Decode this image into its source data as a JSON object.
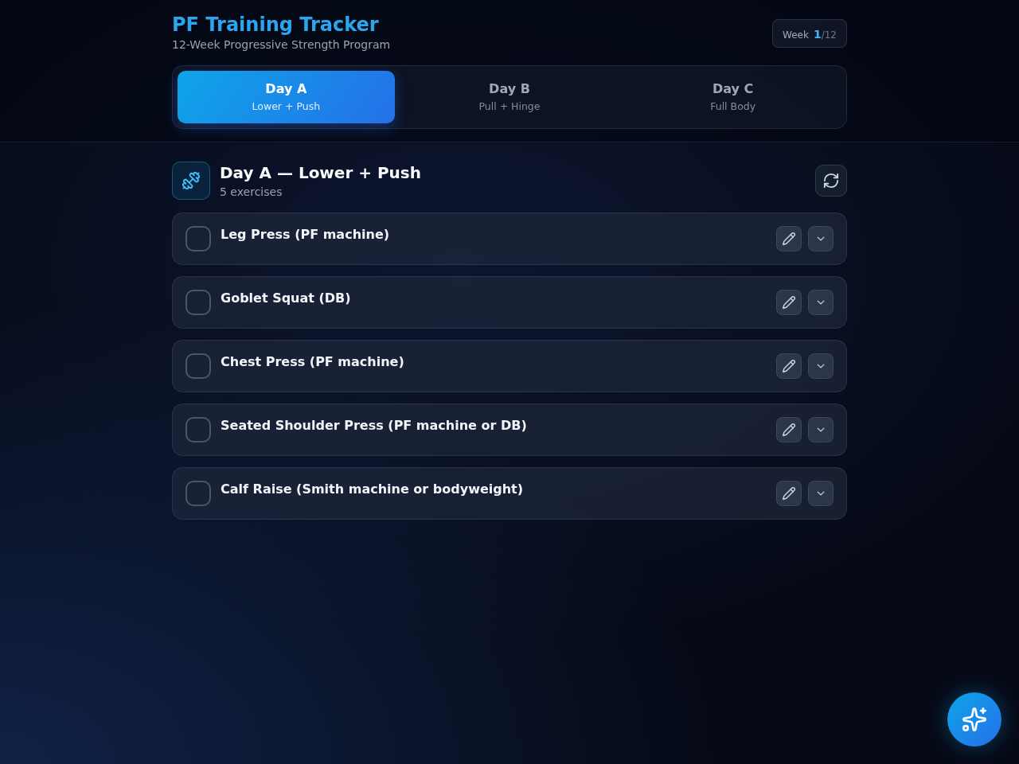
{
  "header": {
    "title": "PF Training Tracker",
    "subtitle": "12-Week Progressive Strength Program",
    "week": {
      "label": "Week",
      "current": "1",
      "total": "/12"
    }
  },
  "tabs": [
    {
      "label": "Day A",
      "sublabel": "Lower + Push",
      "selected": true
    },
    {
      "label": "Day B",
      "sublabel": "Pull + Hinge",
      "selected": false
    },
    {
      "label": "Day C",
      "sublabel": "Full Body",
      "selected": false
    }
  ],
  "section": {
    "title": "Day A — Lower + Push",
    "count": "5 exercises"
  },
  "exercises": [
    {
      "name": "Leg Press (PF machine)",
      "checked": false
    },
    {
      "name": "Goblet Squat (DB)",
      "checked": false
    },
    {
      "name": "Chest Press (PF machine)",
      "checked": false
    },
    {
      "name": "Seated Shoulder Press (PF machine or DB)",
      "checked": false
    },
    {
      "name": "Calf Raise (Smith machine or bodyweight)",
      "checked": false
    }
  ]
}
